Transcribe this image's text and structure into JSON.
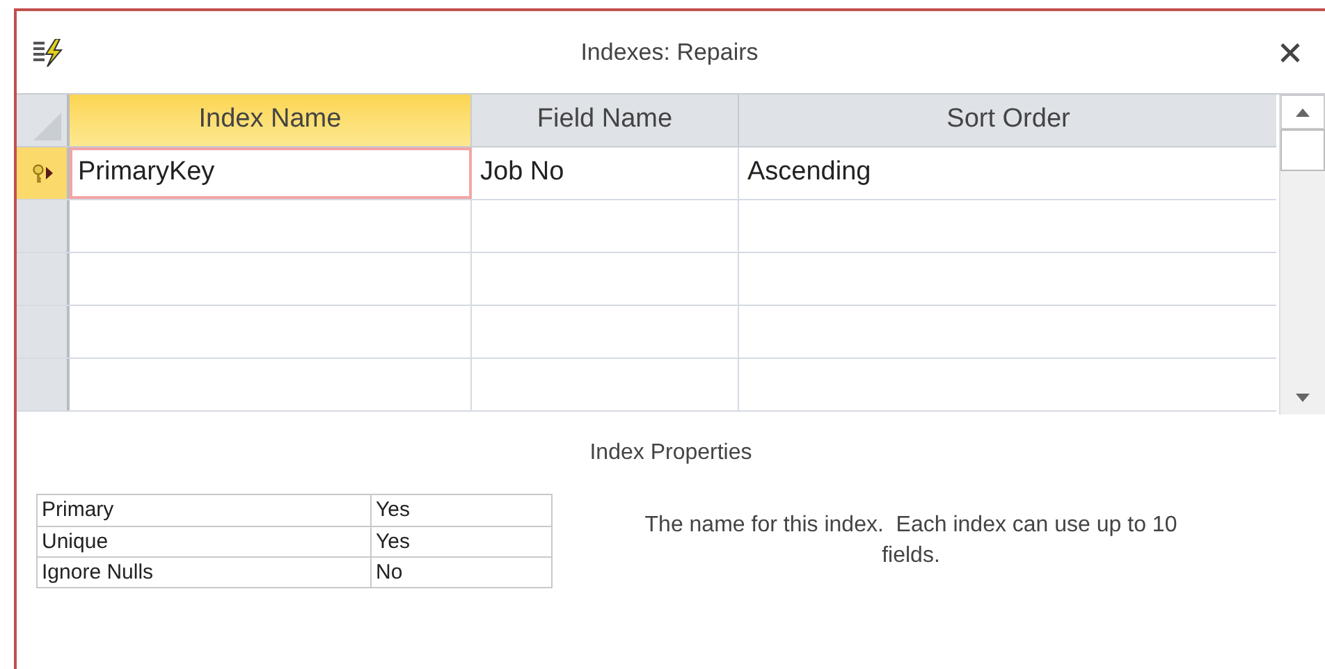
{
  "window": {
    "title": "Indexes: Repairs"
  },
  "grid": {
    "columns": [
      {
        "label": "Index Name",
        "selected": true
      },
      {
        "label": "Field Name",
        "selected": false
      },
      {
        "label": "Sort Order",
        "selected": false
      }
    ],
    "rows": [
      {
        "cells": [
          "PrimaryKey",
          "Job No",
          "Ascending"
        ],
        "current": true,
        "primary_key": true
      }
    ]
  },
  "properties": {
    "title": "Index Properties",
    "items": [
      {
        "label": "Primary",
        "value": "Yes"
      },
      {
        "label": "Unique",
        "value": "Yes"
      },
      {
        "label": "Ignore Nulls",
        "value": "No"
      }
    ],
    "help": "The name for this index.  Each index can use up to 10 fields."
  }
}
